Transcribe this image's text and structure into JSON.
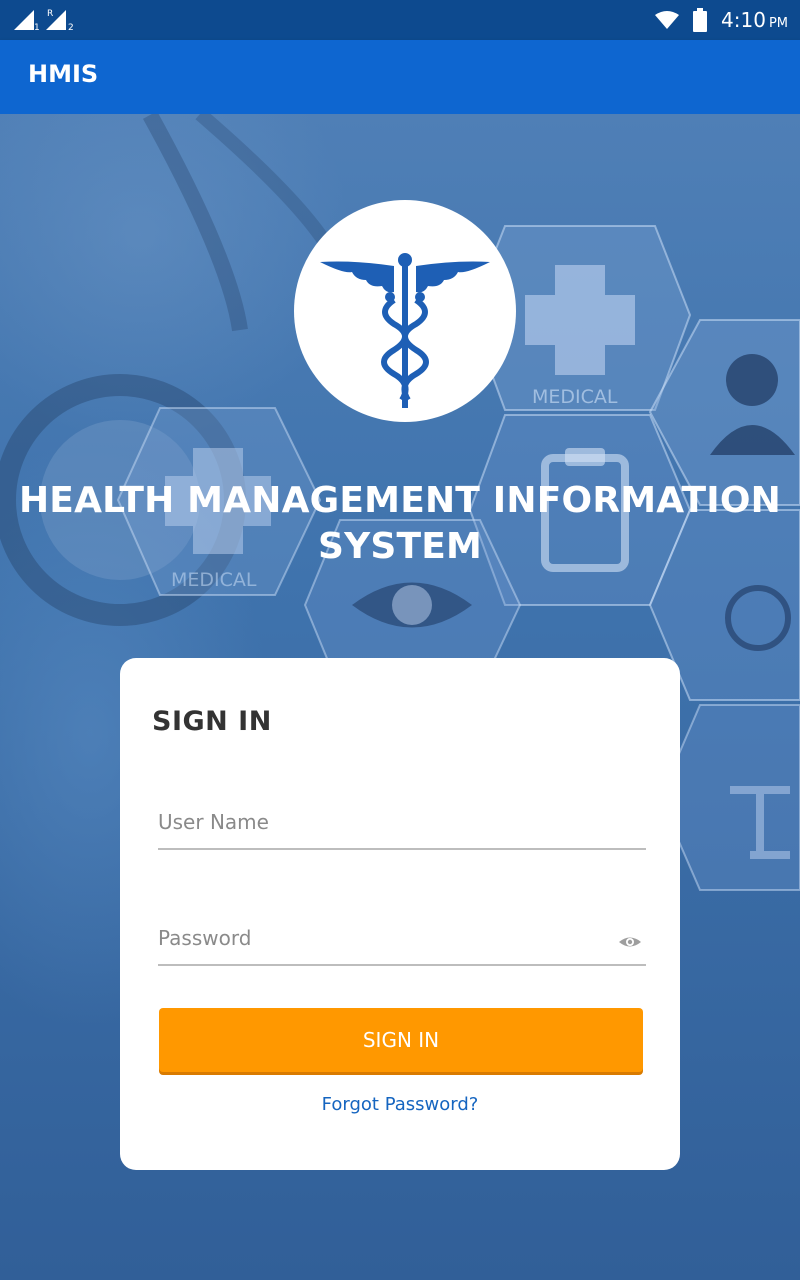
{
  "status_bar": {
    "sim1_label": "1",
    "roaming_label": "R",
    "sim2_label": "2",
    "time": "4:10",
    "ampm": "PM",
    "icons": [
      "signal-icon",
      "signal-roaming-icon",
      "wifi-icon",
      "battery-icon"
    ]
  },
  "appbar": {
    "title": "HMIS"
  },
  "hero": {
    "logo_icon": "caduceus-icon",
    "title_line1": "HEALTH MANAGEMENT INFORMATION",
    "title_line2": "SYSTEM",
    "background_labels": [
      "MEDICAL",
      "MEDICAL"
    ]
  },
  "signin_card": {
    "title": "SIGN IN",
    "username_placeholder": "User Name",
    "username_value": "",
    "password_placeholder": "Password",
    "password_value": "",
    "submit_label": "SIGN IN",
    "forgot_label": "Forgot Password?"
  },
  "colors": {
    "status_bar": "#0d4a8f",
    "app_bar": "#0e66d0",
    "button": "#ff9800",
    "link": "#1565c0",
    "logo_blue": "#1e5fb5"
  }
}
